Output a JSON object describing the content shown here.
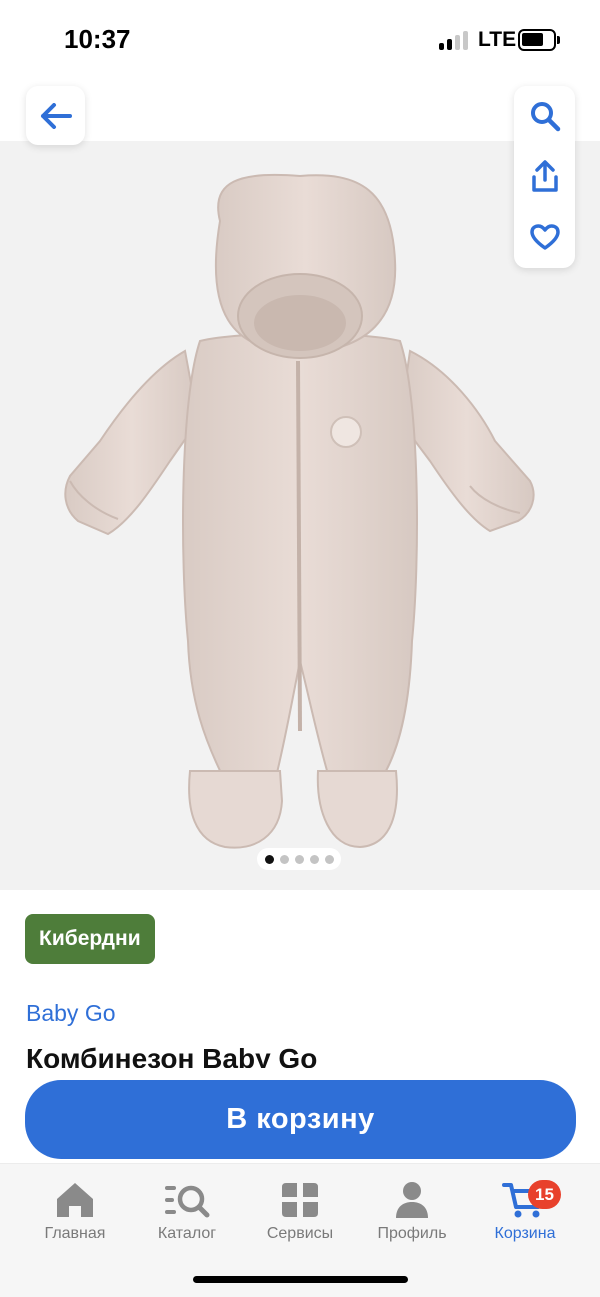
{
  "status_bar": {
    "time": "10:37",
    "network": "LTE"
  },
  "header": {
    "back_icon": "arrow-left-icon",
    "actions": [
      "search-icon",
      "share-icon",
      "heart-icon"
    ]
  },
  "gallery": {
    "total_images": 5,
    "active_index": 0
  },
  "product": {
    "promo_badge": "Кибердни",
    "brand": "Baby Go",
    "title": "Комбинезон Baby Go"
  },
  "cart_button": {
    "label": "В корзину"
  },
  "tab_bar": {
    "items": [
      {
        "label": "Главная",
        "icon": "home-icon"
      },
      {
        "label": "Каталог",
        "icon": "catalog-search-icon"
      },
      {
        "label": "Сервисы",
        "icon": "services-grid-icon"
      },
      {
        "label": "Профиль",
        "icon": "profile-icon"
      },
      {
        "label": "Корзина",
        "icon": "cart-icon"
      }
    ],
    "active": "Корзина",
    "cart_count": "15"
  },
  "colors": {
    "accent": "#2f6fd7",
    "promo": "#4e7d3a",
    "badge": "#e8412c"
  }
}
